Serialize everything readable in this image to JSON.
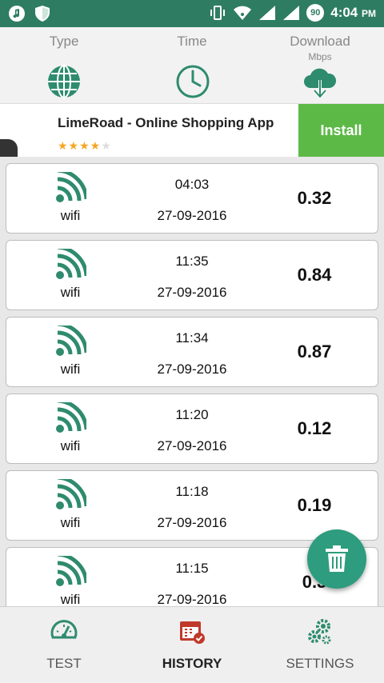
{
  "status_bar": {
    "time": "4:04",
    "ampm": "PM",
    "notification_count": "90",
    "icons": [
      "music-icon",
      "shield-icon",
      "vibrate-icon",
      "wifi-icon",
      "signal-icon",
      "signal-icon",
      "notification-badge"
    ]
  },
  "header": {
    "columns": [
      {
        "label": "Type",
        "icon": "globe-icon"
      },
      {
        "label": "Time",
        "icon": "clock-icon"
      },
      {
        "label": "Download",
        "sub": "Mbps",
        "icon": "cloud-download-icon"
      }
    ]
  },
  "ad": {
    "title": "LimeRoad - Online Shopping App",
    "stars_filled": "★★★★",
    "stars_empty": "★",
    "install_label": "Install"
  },
  "history": [
    {
      "type": "wifi",
      "time": "04:03",
      "date": "27-09-2016",
      "speed": "0.32"
    },
    {
      "type": "wifi",
      "time": "11:35",
      "date": "27-09-2016",
      "speed": "0.84"
    },
    {
      "type": "wifi",
      "time": "11:34",
      "date": "27-09-2016",
      "speed": "0.87"
    },
    {
      "type": "wifi",
      "time": "11:20",
      "date": "27-09-2016",
      "speed": "0.12"
    },
    {
      "type": "wifi",
      "time": "11:18",
      "date": "27-09-2016",
      "speed": "0.19"
    },
    {
      "type": "wifi",
      "time": "11:15",
      "date": "27-09-2016",
      "speed": "0.3"
    }
  ],
  "bottom_nav": [
    {
      "label": "TEST",
      "icon": "speedometer-icon",
      "active": false
    },
    {
      "label": "HISTORY",
      "icon": "calendar-check-icon",
      "active": true
    },
    {
      "label": "SETTINGS",
      "icon": "gears-icon",
      "active": false
    }
  ],
  "colors": {
    "primary": "#2e7d63",
    "accent": "#2e9c7e",
    "install": "#5cb946",
    "history_icon": "#c0392b"
  }
}
